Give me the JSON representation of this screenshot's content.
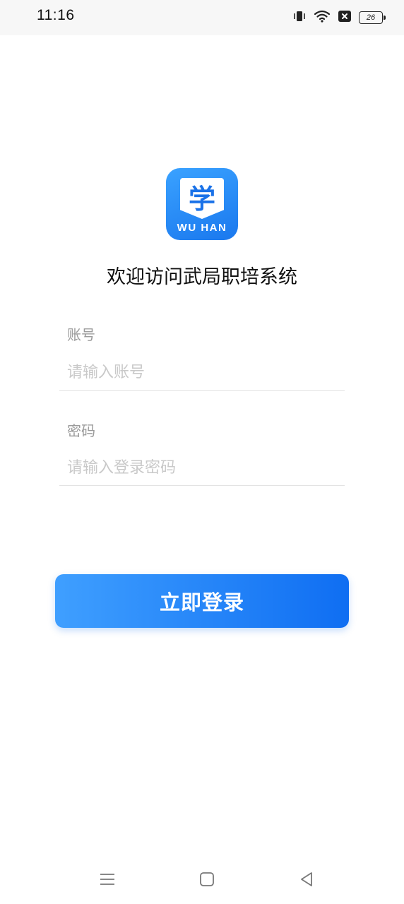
{
  "status_bar": {
    "time": "11:16",
    "battery_level": "26",
    "icons": [
      "vibrate-icon",
      "wifi-icon",
      "notification-x-icon",
      "battery-icon"
    ]
  },
  "logo": {
    "character": "学",
    "text": "WU HAN"
  },
  "welcome_title": "欢迎访问武局职培系统",
  "form": {
    "account": {
      "label": "账号",
      "placeholder": "请输入账号",
      "value": ""
    },
    "password": {
      "label": "密码",
      "placeholder": "请输入登录密码",
      "value": ""
    }
  },
  "login_button_label": "立即登录",
  "nav_bar": {
    "buttons": [
      "menu-icon",
      "home-icon",
      "back-icon"
    ]
  },
  "colors": {
    "accent": "#1a78ee",
    "accent_light": "#3f9fff",
    "label_gray": "#9a9a9a",
    "placeholder_gray": "#c9c9c9"
  }
}
